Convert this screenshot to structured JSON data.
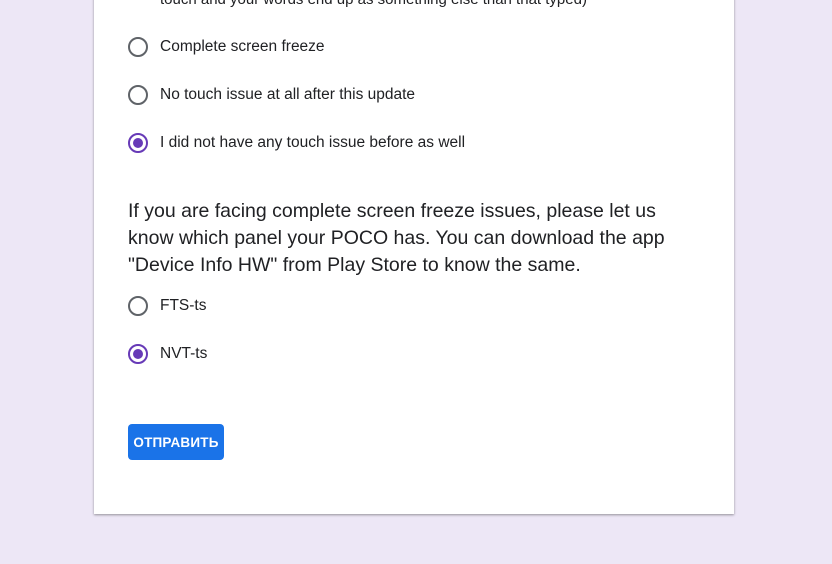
{
  "form": {
    "cut_off_text": "touch and your words end up as something else than that typed)",
    "question1_options": [
      {
        "label": "Complete screen freeze",
        "checked": false
      },
      {
        "label": "No touch issue at all after this update",
        "checked": false
      },
      {
        "label": "I did not have any touch issue before as well",
        "checked": true
      }
    ],
    "question2": {
      "text": "If you are facing complete screen freeze issues, please let us know which panel your POCO has. You can download the app \"Device Info HW\" from Play Store to know the same.",
      "options": [
        {
          "label": "FTS-ts",
          "checked": false
        },
        {
          "label": "NVT-ts",
          "checked": true
        }
      ]
    },
    "submit_label": "ОТПРАВИТЬ"
  },
  "colors": {
    "background": "#ede7f6",
    "accent": "#673ab7",
    "button": "#1a73e8"
  }
}
